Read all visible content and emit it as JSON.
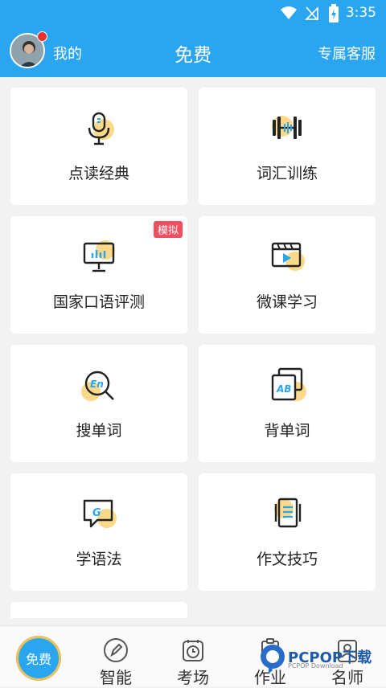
{
  "status": {
    "time": "3:35"
  },
  "header": {
    "me": "我的",
    "title": "免费",
    "service": "专属客服"
  },
  "cards": [
    {
      "label": "点读经典"
    },
    {
      "label": "词汇训练"
    },
    {
      "label": "国家口语评测",
      "badge": "模拟"
    },
    {
      "label": "微课学习"
    },
    {
      "label": "搜单词"
    },
    {
      "label": "背单词"
    },
    {
      "label": "学语法"
    },
    {
      "label": "作文技巧"
    }
  ],
  "nav": {
    "free": "免费",
    "smart": "智能",
    "exam": "考场",
    "homework": "作业",
    "teacher": "名师"
  },
  "watermark": {
    "main": "PCPOP下载",
    "sub": "PCPOP Download"
  },
  "colors": {
    "primary": "#2aa6f0",
    "accent_circle": "#fbd98a",
    "badge": "#ef4f5e"
  }
}
